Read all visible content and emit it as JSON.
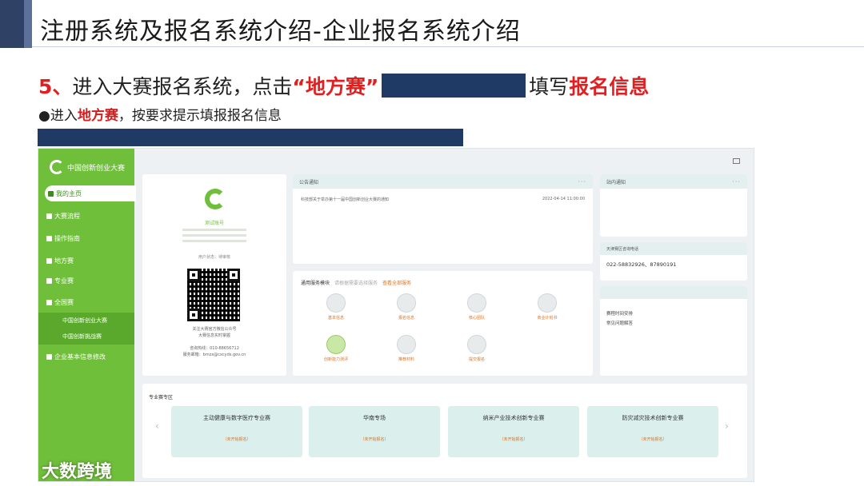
{
  "slide": {
    "title": "注册系统及报名系统介绍-企业报名系统介绍",
    "step_number": "5、",
    "step_text_1": "进入大赛报名系统，点击",
    "step_highlight_1": "“地方赛”",
    "step_text_2": "填写",
    "step_highlight_2": "报名信息",
    "bullet_prefix": "●进入",
    "bullet_highlight": "地方赛",
    "bullet_suffix": "，按要求提示填报报名信息",
    "watermark": "大数跨境"
  },
  "app": {
    "logo_text": "中国创新创业大赛",
    "sidebar": {
      "items": [
        {
          "label": "我的主页"
        },
        {
          "label": "大赛流程"
        },
        {
          "label": "操作指南"
        },
        {
          "label": "地方赛"
        },
        {
          "label": "专业赛"
        },
        {
          "label": "全国赛"
        },
        {
          "label": "企业基本信息修改"
        }
      ],
      "sub_items": [
        {
          "label": "中国创新创业大赛"
        },
        {
          "label": "中国创新挑战赛"
        }
      ]
    },
    "profile": {
      "name": "测试账号",
      "status": "用户状态：待审核",
      "qr_caption_1": "关注大赛官方微信公众号",
      "qr_caption_2": "大赛信息实时掌握",
      "hotline": "咨询热线：010-88656712",
      "email": "服务邮箱：bmzx@cxcyds.gov.cn"
    },
    "notice": {
      "title": "公告通知",
      "more": "···",
      "row_text": "科技部关于举办第十一届中国创新创业大赛的通知",
      "row_date": "2022-04-14 11:00:00"
    },
    "tools": {
      "title": "通用服务模块",
      "subtitle": "请根据需要选择服务",
      "link": "查看全部服务",
      "items": [
        {
          "label": "基本信息"
        },
        {
          "label": "报名信息"
        },
        {
          "label": "核心团队"
        },
        {
          "label": "商业计划书"
        },
        {
          "label": "创新能力测评"
        },
        {
          "label": "推荐材料"
        },
        {
          "label": "提交报名"
        }
      ]
    },
    "right_notice": {
      "title": "站内通知",
      "more": "···"
    },
    "contact": {
      "title": "天津赛区咨询电话",
      "phone": "022-58832926、87890191"
    },
    "links": {
      "items": [
        {
          "label": "赛程时间安排"
        },
        {
          "label": "常见问题解答"
        }
      ]
    },
    "tracks": {
      "title": "专业赛专区",
      "items": [
        {
          "name": "主动健康与数字医疗专业赛",
          "state": "（未开始报名）"
        },
        {
          "name": "华南专场",
          "state": "（未开始报名）"
        },
        {
          "name": "纳米产业技术创新专业赛",
          "state": "（未开始报名）"
        },
        {
          "name": "防灾减灾技术创新专业赛",
          "state": "（未开始报名）"
        }
      ]
    }
  }
}
